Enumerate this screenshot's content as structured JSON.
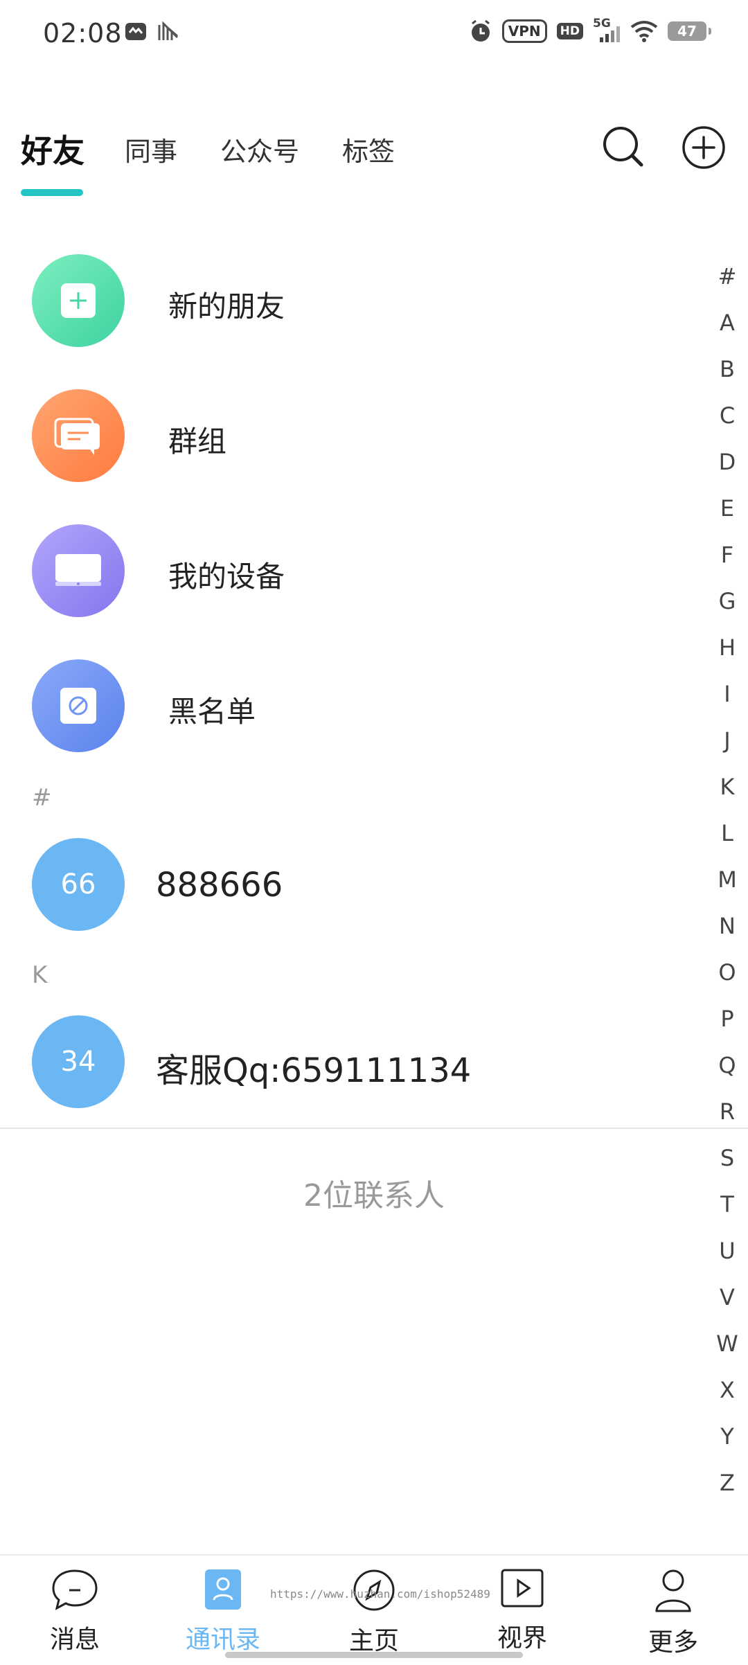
{
  "status_bar": {
    "time": "02:08",
    "vpn": "VPN",
    "hd": "HD",
    "network": "5G",
    "battery": "47"
  },
  "tabs": [
    {
      "label": "好友",
      "active": true
    },
    {
      "label": "同事",
      "active": false
    },
    {
      "label": "公众号",
      "active": false
    },
    {
      "label": "标签",
      "active": false
    }
  ],
  "functions": [
    {
      "label": "新的朋友",
      "icon": "add-friend-icon"
    },
    {
      "label": "群组",
      "icon": "group-chat-icon"
    },
    {
      "label": "我的设备",
      "icon": "device-icon"
    },
    {
      "label": "黑名单",
      "icon": "blacklist-icon"
    }
  ],
  "sections": [
    {
      "header": "#",
      "contacts": [
        {
          "avatar_text": "66",
          "name": "888666"
        }
      ]
    },
    {
      "header": "K",
      "contacts": [
        {
          "avatar_text": "34",
          "name": "客服Qq:659111134"
        }
      ]
    }
  ],
  "contact_count": "2位联系人",
  "alphabet": [
    "#",
    "A",
    "B",
    "C",
    "D",
    "E",
    "F",
    "G",
    "H",
    "I",
    "J",
    "K",
    "L",
    "M",
    "N",
    "O",
    "P",
    "Q",
    "R",
    "S",
    "T",
    "U",
    "V",
    "W",
    "X",
    "Y",
    "Z"
  ],
  "bottom_nav": [
    {
      "label": "消息",
      "icon": "chat-bubble-icon",
      "active": false
    },
    {
      "label": "通讯录",
      "icon": "contacts-icon",
      "active": true
    },
    {
      "label": "主页",
      "icon": "compass-icon",
      "active": false
    },
    {
      "label": "视界",
      "icon": "video-play-icon",
      "active": false
    },
    {
      "label": "更多",
      "icon": "person-icon",
      "active": false
    }
  ],
  "watermark": "https://www.huzhan.com/ishop52489",
  "colors": {
    "accent": "#22c4c4",
    "avatar": "#6ab7f4",
    "new_friend": "#5fe0ae",
    "group": "#ff8e55",
    "device": "#9b90f3",
    "blacklist": "#6f94f4"
  }
}
